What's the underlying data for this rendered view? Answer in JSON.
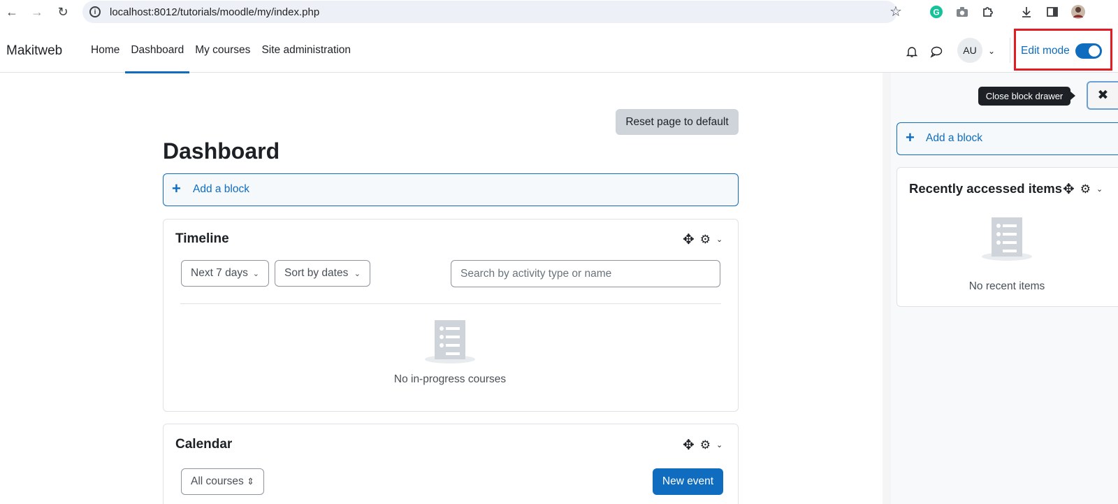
{
  "browser": {
    "url": "localhost:8012/tutorials/moodle/my/index.php",
    "back_glyph": "←",
    "forward_glyph": "→",
    "reload_glyph": "↻",
    "info_glyph": "i",
    "star_glyph": "☆"
  },
  "navbar": {
    "brand": "Makitweb",
    "items": [
      {
        "label": "Home",
        "active": false
      },
      {
        "label": "Dashboard",
        "active": true
      },
      {
        "label": "My courses",
        "active": false
      },
      {
        "label": "Site administration",
        "active": false
      }
    ],
    "avatar_initials": "AU",
    "avatar_chevron": "⌄",
    "edit_mode_label": "Edit mode",
    "edit_mode_on": true
  },
  "main": {
    "reset_button": "Reset page to default",
    "page_title": "Dashboard",
    "add_block_plus": "+",
    "add_block_label": "Add a block",
    "control_glyphs": {
      "move": "✥",
      "gear": "⚙",
      "chevron": "⌄",
      "caret": "⌄",
      "updown": "⇕"
    },
    "timeline": {
      "title": "Timeline",
      "filter_days": "Next 7 days",
      "sort": "Sort by dates",
      "search_placeholder": "Search by activity type or name",
      "empty_text": "No in-progress courses"
    },
    "calendar": {
      "title": "Calendar",
      "course_select": "All courses",
      "new_event": "New event"
    }
  },
  "drawer": {
    "tooltip": "Close block drawer",
    "close_glyph": "✖",
    "add_block_plus": "+",
    "add_block_label": "Add a block",
    "recent": {
      "title": "Recently accessed items",
      "empty_text": "No recent items"
    }
  },
  "colors": {
    "accent": "#0f6cbf",
    "highlight_box": "#e31b23",
    "tooltip_bg": "#1d2125",
    "reset_bg": "#ced4da"
  }
}
